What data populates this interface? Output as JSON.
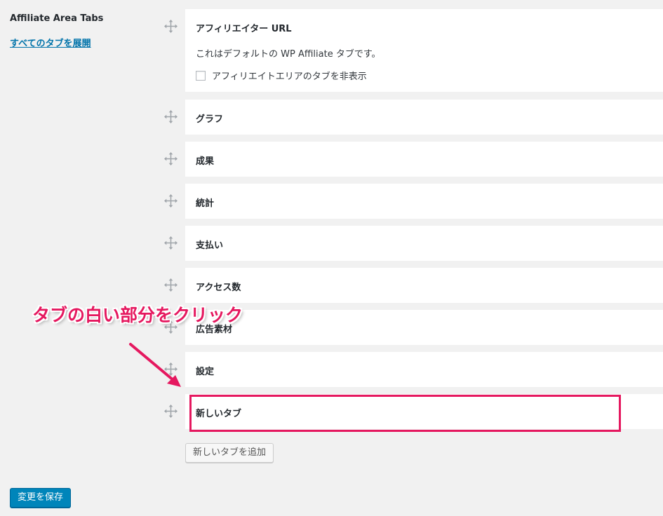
{
  "sidebar": {
    "section_title": "Affiliate Area Tabs",
    "expand_link": "すべてのタブを展開"
  },
  "tabs": [
    {
      "title": "アフィリエイター URL",
      "description": "これはデフォルトの WP Affiliate タブです。",
      "hide_checkbox_label": "アフィリエイトエリアのタブを非表示",
      "hide_checked": false
    },
    {
      "title": "グラフ"
    },
    {
      "title": "成果"
    },
    {
      "title": "統計"
    },
    {
      "title": "支払い"
    },
    {
      "title": "アクセス数"
    },
    {
      "title": "広告素材"
    },
    {
      "title": "設定"
    },
    {
      "title": "新しいタブ"
    }
  ],
  "buttons": {
    "add_tab": "新しいタブを追加",
    "save": "変更を保存"
  },
  "annotation": {
    "callout": "タブの白い部分をクリック",
    "color": "#e5185f"
  },
  "colors": {
    "background": "#f1f1f1",
    "link": "#0073aa",
    "primary_button": "#0085ba"
  },
  "icons": {
    "drag_handle": "move-arrows-icon"
  }
}
